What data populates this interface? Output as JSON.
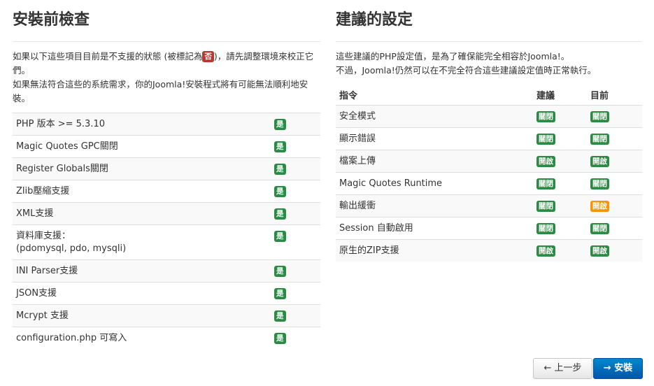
{
  "left": {
    "title": "安裝前檢查",
    "intro_before_badge": "如果以下這些項目目前是不支援的狀態 (被標記為",
    "intro_badge": "否",
    "intro_after_badge": ")，請先調整環境來校正它們。",
    "intro_line2": "如果無法符合這些的系統需求，你的Joomla!安裝程式將有可能無法順利地安裝。",
    "checks": [
      {
        "label": "PHP 版本 >= 5.3.10",
        "status": "是"
      },
      {
        "label": "Magic Quotes GPC關閉",
        "status": "是"
      },
      {
        "label": "Register Globals關閉",
        "status": "是"
      },
      {
        "label": "Zlib壓縮支援",
        "status": "是"
      },
      {
        "label": "XML支援",
        "status": "是"
      },
      {
        "label": "資料庫支援：",
        "label2": "(pdomysql, pdo, mysqli)",
        "status": "是"
      },
      {
        "label": "INI Parser支援",
        "status": "是"
      },
      {
        "label": "JSON支援",
        "status": "是"
      },
      {
        "label": "Mcrypt 支援",
        "status": "是"
      },
      {
        "label": "configuration.php 可寫入",
        "status": "是"
      }
    ]
  },
  "right": {
    "title": "建議的設定",
    "intro_line1": "這些建議的PHP設定值，是為了確保能完全相容於Joomla!。",
    "intro_line2": "不過，Joomla!仍然可以在不完全符合這些建議設定值時正常執行。",
    "headers": {
      "directive": "指令",
      "recommended": "建議",
      "actual": "目前"
    },
    "settings": [
      {
        "name": "安全模式",
        "recommended": "關閉",
        "actual": "關閉",
        "actual_color": "#2d8a44"
      },
      {
        "name": "顯示錯誤",
        "recommended": "關閉",
        "actual": "關閉",
        "actual_color": "#2d8a44"
      },
      {
        "name": "檔案上傳",
        "recommended": "開啟",
        "actual": "開啟",
        "actual_color": "#2d8a44"
      },
      {
        "name": "Magic Quotes Runtime",
        "recommended": "關閉",
        "actual": "關閉",
        "actual_color": "#2d8a44"
      },
      {
        "name": "輸出緩衝",
        "recommended": "關閉",
        "actual": "開啟",
        "actual_color": "#f89406"
      },
      {
        "name": "Session 自動啟用",
        "recommended": "關閉",
        "actual": "關閉",
        "actual_color": "#2d8a44"
      },
      {
        "name": "原生的ZIP支援",
        "recommended": "開啟",
        "actual": "開啟",
        "actual_color": "#2d8a44"
      }
    ]
  },
  "buttons": {
    "prev_label": "上一步",
    "prev_icon": "arrow-left-icon",
    "install_label": "安裝",
    "install_icon": "arrow-right-icon"
  },
  "colors": {
    "ok": "#2d8a44",
    "error": "#bd362f",
    "warning": "#f89406",
    "primary": "#0066bb"
  }
}
